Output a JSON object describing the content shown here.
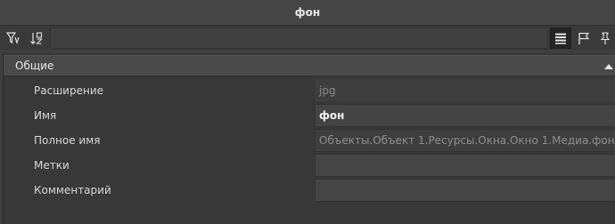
{
  "window": {
    "title": "фон"
  },
  "toolbar": {
    "filter_value": "",
    "buttons": [
      {
        "icon": "filter-icon"
      },
      {
        "icon": "sort-icon"
      },
      {
        "icon": "list-view-icon"
      },
      {
        "icon": "flag-icon"
      },
      {
        "icon": "pin-icon"
      }
    ]
  },
  "section": {
    "title": "Общие"
  },
  "properties": [
    {
      "label": "Расширение",
      "value": "jpg"
    },
    {
      "label": "Имя",
      "value": "фон"
    },
    {
      "label": "Полное имя",
      "value": "Объекты.Объект 1.Ресурсы.Окна.Окно 1.Медиа.фон"
    },
    {
      "label": "Метки",
      "value": ""
    },
    {
      "label": "Комментарий",
      "value": ""
    }
  ]
}
